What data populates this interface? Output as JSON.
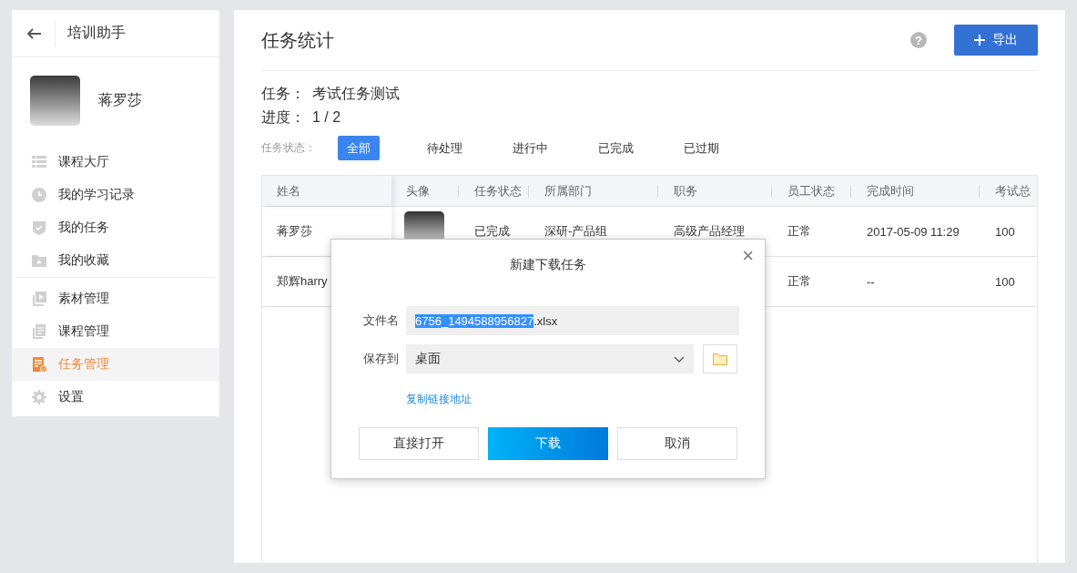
{
  "sidebar": {
    "title": "培训助手",
    "user": {
      "name": "蒋罗莎"
    },
    "menu_groups": [
      {
        "items": [
          {
            "label": "课程大厅",
            "selected": false
          },
          {
            "label": "我的学习记录",
            "selected": false
          },
          {
            "label": "我的任务",
            "selected": false
          },
          {
            "label": "我的收藏",
            "selected": false
          }
        ]
      },
      {
        "items": [
          {
            "label": "素材管理",
            "selected": false
          },
          {
            "label": "课程管理",
            "selected": false
          },
          {
            "label": "任务管理",
            "selected": true
          },
          {
            "label": "设置",
            "selected": false
          }
        ]
      }
    ]
  },
  "page": {
    "title": "任务统计",
    "help": "?",
    "export_button": "导出",
    "task_label": "任务：",
    "task_name": "考试任务测试",
    "progress_label": "进度：",
    "progress": "1 / 2",
    "filters": {
      "label": "任务状态：",
      "items": [
        {
          "label": "全部",
          "selected": true
        },
        {
          "label": "待处理",
          "selected": false
        },
        {
          "label": "进行中",
          "selected": false
        },
        {
          "label": "已完成",
          "selected": false
        },
        {
          "label": "已过期",
          "selected": false
        }
      ]
    },
    "table": {
      "columns": [
        "姓名",
        "头像",
        "任务状态",
        "所属部门",
        "职务",
        "员工状态",
        "完成时间",
        "考试总"
      ],
      "rows": [
        {
          "name": "蒋罗莎",
          "task_status": "已完成",
          "department": "深研-产品组",
          "position": "高级产品经理",
          "employee_status": "正常",
          "completed_at": "2017-05-09 11:29",
          "exam_score": "100"
        },
        {
          "name": "郑辉harry",
          "employee_status": "正常",
          "completed_at": "--",
          "exam_score": "100"
        }
      ]
    }
  },
  "dialog": {
    "title": "新建下载任务",
    "close": "×",
    "file_label": "文件名",
    "file_name_selected": "6756_1494588956827",
    "file_name_rest": ".xlsx",
    "save_label": "保存到",
    "save_location": "桌面",
    "copy_link": "复制链接地址",
    "buttons": [
      {
        "label": "直接打开",
        "kind": "default"
      },
      {
        "label": "下载",
        "kind": "primary"
      },
      {
        "label": "取消",
        "kind": "default"
      }
    ]
  }
}
